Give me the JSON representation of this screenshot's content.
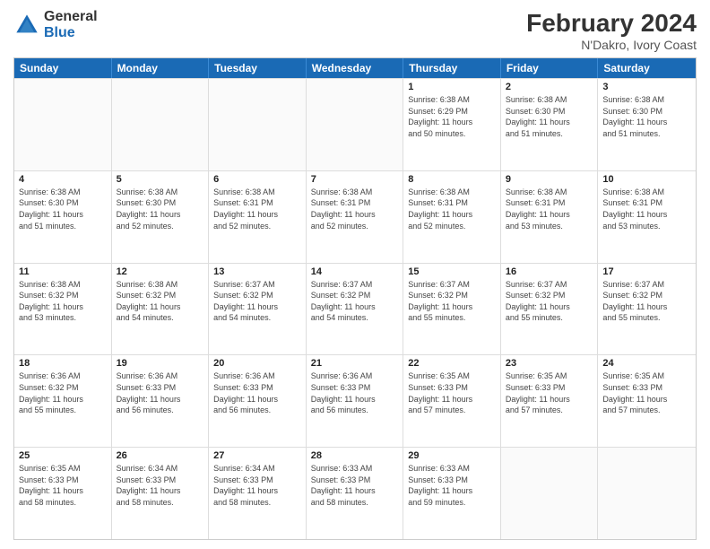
{
  "logo": {
    "general": "General",
    "blue": "Blue"
  },
  "title": {
    "main": "February 2024",
    "sub": "N'Dakro, Ivory Coast"
  },
  "calendar": {
    "days": [
      "Sunday",
      "Monday",
      "Tuesday",
      "Wednesday",
      "Thursday",
      "Friday",
      "Saturday"
    ],
    "weeks": [
      [
        {
          "date": "",
          "info": ""
        },
        {
          "date": "",
          "info": ""
        },
        {
          "date": "",
          "info": ""
        },
        {
          "date": "",
          "info": ""
        },
        {
          "date": "1",
          "info": "Sunrise: 6:38 AM\nSunset: 6:29 PM\nDaylight: 11 hours\nand 50 minutes."
        },
        {
          "date": "2",
          "info": "Sunrise: 6:38 AM\nSunset: 6:30 PM\nDaylight: 11 hours\nand 51 minutes."
        },
        {
          "date": "3",
          "info": "Sunrise: 6:38 AM\nSunset: 6:30 PM\nDaylight: 11 hours\nand 51 minutes."
        }
      ],
      [
        {
          "date": "4",
          "info": "Sunrise: 6:38 AM\nSunset: 6:30 PM\nDaylight: 11 hours\nand 51 minutes."
        },
        {
          "date": "5",
          "info": "Sunrise: 6:38 AM\nSunset: 6:30 PM\nDaylight: 11 hours\nand 52 minutes."
        },
        {
          "date": "6",
          "info": "Sunrise: 6:38 AM\nSunset: 6:31 PM\nDaylight: 11 hours\nand 52 minutes."
        },
        {
          "date": "7",
          "info": "Sunrise: 6:38 AM\nSunset: 6:31 PM\nDaylight: 11 hours\nand 52 minutes."
        },
        {
          "date": "8",
          "info": "Sunrise: 6:38 AM\nSunset: 6:31 PM\nDaylight: 11 hours\nand 52 minutes."
        },
        {
          "date": "9",
          "info": "Sunrise: 6:38 AM\nSunset: 6:31 PM\nDaylight: 11 hours\nand 53 minutes."
        },
        {
          "date": "10",
          "info": "Sunrise: 6:38 AM\nSunset: 6:31 PM\nDaylight: 11 hours\nand 53 minutes."
        }
      ],
      [
        {
          "date": "11",
          "info": "Sunrise: 6:38 AM\nSunset: 6:32 PM\nDaylight: 11 hours\nand 53 minutes."
        },
        {
          "date": "12",
          "info": "Sunrise: 6:38 AM\nSunset: 6:32 PM\nDaylight: 11 hours\nand 54 minutes."
        },
        {
          "date": "13",
          "info": "Sunrise: 6:37 AM\nSunset: 6:32 PM\nDaylight: 11 hours\nand 54 minutes."
        },
        {
          "date": "14",
          "info": "Sunrise: 6:37 AM\nSunset: 6:32 PM\nDaylight: 11 hours\nand 54 minutes."
        },
        {
          "date": "15",
          "info": "Sunrise: 6:37 AM\nSunset: 6:32 PM\nDaylight: 11 hours\nand 55 minutes."
        },
        {
          "date": "16",
          "info": "Sunrise: 6:37 AM\nSunset: 6:32 PM\nDaylight: 11 hours\nand 55 minutes."
        },
        {
          "date": "17",
          "info": "Sunrise: 6:37 AM\nSunset: 6:32 PM\nDaylight: 11 hours\nand 55 minutes."
        }
      ],
      [
        {
          "date": "18",
          "info": "Sunrise: 6:36 AM\nSunset: 6:32 PM\nDaylight: 11 hours\nand 55 minutes."
        },
        {
          "date": "19",
          "info": "Sunrise: 6:36 AM\nSunset: 6:33 PM\nDaylight: 11 hours\nand 56 minutes."
        },
        {
          "date": "20",
          "info": "Sunrise: 6:36 AM\nSunset: 6:33 PM\nDaylight: 11 hours\nand 56 minutes."
        },
        {
          "date": "21",
          "info": "Sunrise: 6:36 AM\nSunset: 6:33 PM\nDaylight: 11 hours\nand 56 minutes."
        },
        {
          "date": "22",
          "info": "Sunrise: 6:35 AM\nSunset: 6:33 PM\nDaylight: 11 hours\nand 57 minutes."
        },
        {
          "date": "23",
          "info": "Sunrise: 6:35 AM\nSunset: 6:33 PM\nDaylight: 11 hours\nand 57 minutes."
        },
        {
          "date": "24",
          "info": "Sunrise: 6:35 AM\nSunset: 6:33 PM\nDaylight: 11 hours\nand 57 minutes."
        }
      ],
      [
        {
          "date": "25",
          "info": "Sunrise: 6:35 AM\nSunset: 6:33 PM\nDaylight: 11 hours\nand 58 minutes."
        },
        {
          "date": "26",
          "info": "Sunrise: 6:34 AM\nSunset: 6:33 PM\nDaylight: 11 hours\nand 58 minutes."
        },
        {
          "date": "27",
          "info": "Sunrise: 6:34 AM\nSunset: 6:33 PM\nDaylight: 11 hours\nand 58 minutes."
        },
        {
          "date": "28",
          "info": "Sunrise: 6:33 AM\nSunset: 6:33 PM\nDaylight: 11 hours\nand 58 minutes."
        },
        {
          "date": "29",
          "info": "Sunrise: 6:33 AM\nSunset: 6:33 PM\nDaylight: 11 hours\nand 59 minutes."
        },
        {
          "date": "",
          "info": ""
        },
        {
          "date": "",
          "info": ""
        }
      ]
    ]
  }
}
